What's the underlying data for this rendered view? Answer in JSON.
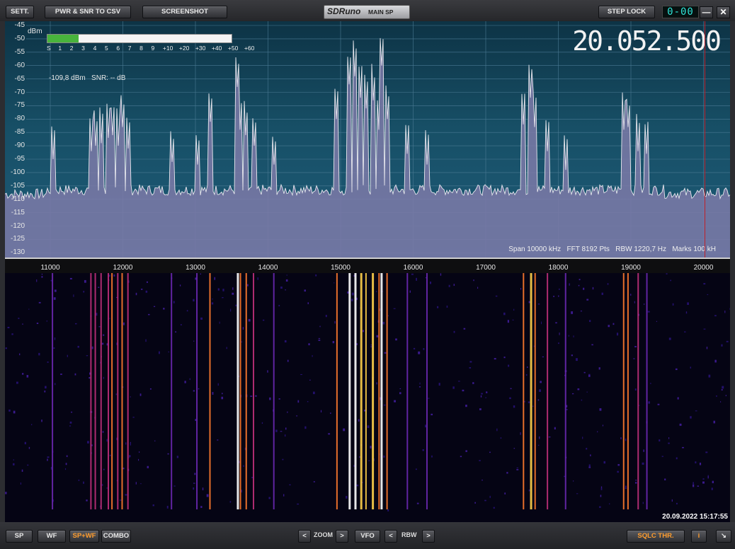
{
  "toolbar": {
    "settings_label": "SETT.",
    "pwr_snr_label": "PWR & SNR TO CSV",
    "screenshot_label": "SCREENSHOT",
    "step_lock_label": "STEP LOCK",
    "step_display": "0-00",
    "minimize_label": "—",
    "close_label": "✕"
  },
  "logo": {
    "brand": "SDRuno",
    "window_name": "MAIN SP"
  },
  "spectrum": {
    "frequency_display": "20.052.500",
    "level_unit": "dBm",
    "s_meter_level_fraction": 0.17,
    "s_meter_scale": [
      "S",
      "1",
      "2",
      "3",
      "4",
      "5",
      "6",
      "7",
      "8",
      "9",
      "+10",
      "+20",
      "+30",
      "+40",
      "+50",
      "+60"
    ],
    "signal_readout": "-109,8 dBm",
    "snr_readout": "SNR: -- dB",
    "span": "Span 10000 kHz",
    "fft": "FFT 8192 Pts",
    "rbw": "RBW 1220,7 Hz",
    "marks": "Marks 100 kH",
    "y_ticks": [
      "-45",
      "-50",
      "-55",
      "-60",
      "-65",
      "-70",
      "-75",
      "-80",
      "-85",
      "-90",
      "-95",
      "-100",
      "-105",
      "-110",
      "-115",
      "-120",
      "-125",
      "-130"
    ],
    "x_ticks": [
      "11000",
      "12000",
      "13000",
      "14000",
      "15000",
      "16000",
      "17000",
      "18000",
      "19000",
      "20000"
    ]
  },
  "waterfall": {
    "timestamp": "20.09.2022 15:17:55"
  },
  "bottom": {
    "sp_label": "SP",
    "wf_label": "WF",
    "spwf_label": "SP+WF",
    "combo_label": "COMBO",
    "zoom_label": "ZOOM",
    "vfo_label": "VFO",
    "rbw_label": "RBW",
    "prev_arrow": "<",
    "next_arrow": ">",
    "sqlc_label": "SQLC THR.",
    "info_label": "i",
    "resize_label": "↘"
  },
  "colors": {
    "accent": "#ff9d2e",
    "spectrum_top": "#0d3345",
    "spectrum_bottom": "#1e5b78",
    "fill": "#7c7aa8",
    "lcd": "#2fe3d6"
  }
}
